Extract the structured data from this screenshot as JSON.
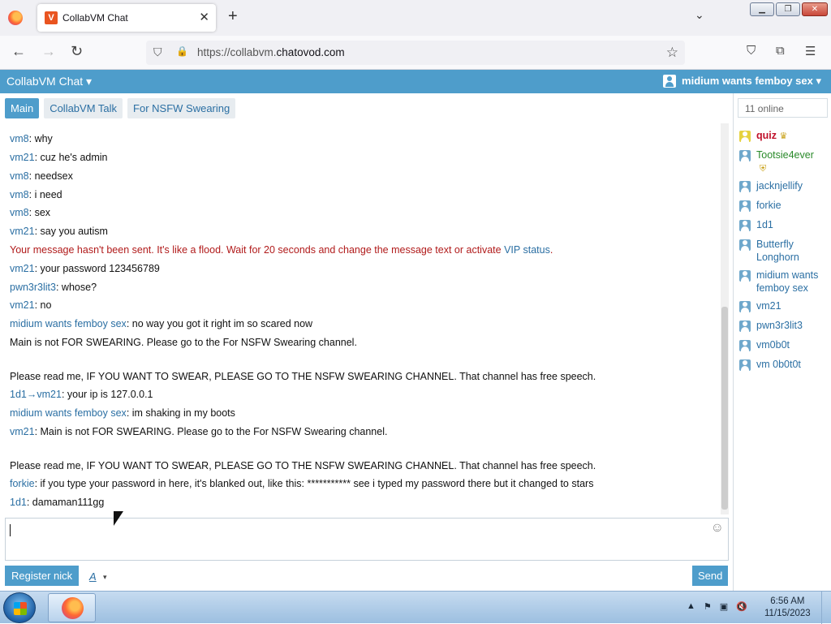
{
  "browser": {
    "tab_title": "CollabVM Chat",
    "tab_favicon": "V",
    "new_tab": "+",
    "close_tab": "✕",
    "url_prefix": "https://collabvm.",
    "url_domain": "chatovod.com",
    "icons": {
      "back": "←",
      "forward": "→",
      "reload": "↻",
      "shield": "⛉",
      "lock": "🔒",
      "star": "☆",
      "pocket": "⛉",
      "extensions": "⧉",
      "menu": "☰",
      "tab_list": "⌄"
    }
  },
  "window_controls": {
    "minimize": "▁",
    "maximize": "❐",
    "close": "✕"
  },
  "app": {
    "title": "CollabVM Chat ▾",
    "user_menu": "midium wants femboy sex ▾",
    "accent": "#4e9dcb",
    "nick_color": "#2b6fa3",
    "error_color": "#b11b1b"
  },
  "channels": [
    "Main",
    "CollabVM Talk",
    "For NSFW Swearing"
  ],
  "messages": [
    {
      "nick": "vm8",
      "text": ": why"
    },
    {
      "nick": "vm21",
      "text": ": cuz he's admin"
    },
    {
      "nick": "vm8",
      "text": ": needsex"
    },
    {
      "nick": "vm8",
      "text": ": i need"
    },
    {
      "nick": "vm8",
      "text": ": sex"
    },
    {
      "nick": "vm21",
      "text": ": say you autism"
    },
    {
      "error": "Your message hasn't been sent. It's like a flood. Wait for 20 seconds and change the message text or activate ",
      "link": "VIP status",
      "tail": "."
    },
    {
      "nick": "vm21",
      "text": ": your password 123456789"
    },
    {
      "nick": "pwn3r3lit3",
      "text": ": whose?"
    },
    {
      "nick": "vm21",
      "text": ": no"
    },
    {
      "nick": "midium wants femboy sex",
      "text": ": no way you got it right im so scared now"
    },
    {
      "plain": "Main is not FOR SWEARING. Please go to the For NSFW Swearing channel."
    },
    {
      "plain": "Please read me, IF YOU WANT TO SWEAR, PLEASE GO TO THE NSFW SWEARING CHANNEL. That channel has free speech."
    },
    {
      "nick": "1d1→vm21",
      "text": ": your ip is 127.0.0.1"
    },
    {
      "nick": "midium wants femboy sex",
      "text": ": im shaking in my boots"
    },
    {
      "nick": "vm21",
      "text": ": Main is not FOR SWEARING. Please go to the For NSFW Swearing channel."
    },
    {
      "plain": "Please read me, IF YOU WANT TO SWEAR, PLEASE GO TO THE NSFW SWEARING CHANNEL. That channel has free speech."
    },
    {
      "nick": "forkie",
      "text": ": if you type your password in here, it's blanked out, like this: *********** see i typed my password there but it changed to stars"
    },
    {
      "nick": "1d1",
      "text": ": damaman111gg"
    }
  ],
  "sidebar": {
    "online_count": "11 online",
    "users": [
      {
        "name": "quiz",
        "role": "admin",
        "badge": "♛"
      },
      {
        "name": "Tootsie4ever",
        "role": "moderator",
        "badge": "⛨"
      },
      {
        "name": "jacknjellify"
      },
      {
        "name": "forkie"
      },
      {
        "name": "1d1"
      },
      {
        "name": "Butterfly Longhorn"
      },
      {
        "name": "midium wants femboy sex"
      },
      {
        "name": "vm21"
      },
      {
        "name": "pwn3r3lit3"
      },
      {
        "name": "vm0b0t"
      },
      {
        "name": "vm 0b0t0t"
      }
    ]
  },
  "composer": {
    "smiley": "☺"
  },
  "buttons": {
    "register": "Register nick",
    "font": "A",
    "font_caret": "▾",
    "send": "Send"
  },
  "taskbar": {
    "tray_icons": [
      "▲",
      "⚑",
      "▣",
      "🔇"
    ],
    "time": "6:56 AM",
    "date": "11/15/2023"
  }
}
